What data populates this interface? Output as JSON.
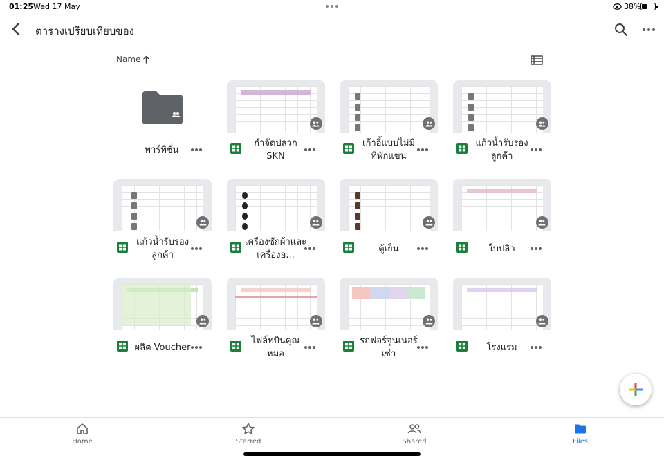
{
  "status": {
    "time": "01:25",
    "date": "Wed 17 May",
    "battery_pct": "38%",
    "battery_level": 0.38
  },
  "header": {
    "title": "ตารางเปรียบเทียบของ",
    "back_icon": "chevron-left-icon",
    "search_icon": "search-icon",
    "more_icon": "more-horizontal-icon"
  },
  "sort": {
    "label": "Name",
    "direction": "ascending",
    "view_icon": "list-view-icon"
  },
  "items": [
    {
      "type": "folder",
      "name": "พาร์ทิชั่น",
      "shared": true
    },
    {
      "type": "sheet",
      "name": "กำจัดปลวก SKN",
      "shared": true
    },
    {
      "type": "sheet",
      "name": "เก้าอี้แบบไม่มีที่พักแขน",
      "shared": true
    },
    {
      "type": "sheet",
      "name": "แก้วน้ำรับรองลูกค้า",
      "shared": true
    },
    {
      "type": "sheet",
      "name": "แก้วน้ำรับรองลูกค้า",
      "shared": true
    },
    {
      "type": "sheet",
      "name": "เครื่องซักผ้าและเครื่องอ...",
      "shared": true
    },
    {
      "type": "sheet",
      "name": "ตู้เย็น",
      "shared": true
    },
    {
      "type": "sheet",
      "name": "ใบปลิว",
      "shared": true
    },
    {
      "type": "sheet",
      "name": "ผลิต Voucher",
      "shared": true
    },
    {
      "type": "sheet",
      "name": "ไฟล์ทบินคุณหมอ",
      "shared": true
    },
    {
      "type": "sheet",
      "name": "รถฟอร์จูนเนอร์เช่า",
      "shared": true
    },
    {
      "type": "sheet",
      "name": "โรงแรม",
      "shared": true
    }
  ],
  "fab": {
    "icon": "plus-icon"
  },
  "bottom_nav": [
    {
      "label": "Home",
      "icon": "home-icon",
      "active": false
    },
    {
      "label": "Starred",
      "icon": "star-icon",
      "active": false
    },
    {
      "label": "Shared",
      "icon": "people-icon",
      "active": false
    },
    {
      "label": "Files",
      "icon": "folder-icon",
      "active": true
    }
  ],
  "colors": {
    "accent": "#1a73e8",
    "sheets_green": "#188038",
    "folder_grey": "#5f6368"
  }
}
